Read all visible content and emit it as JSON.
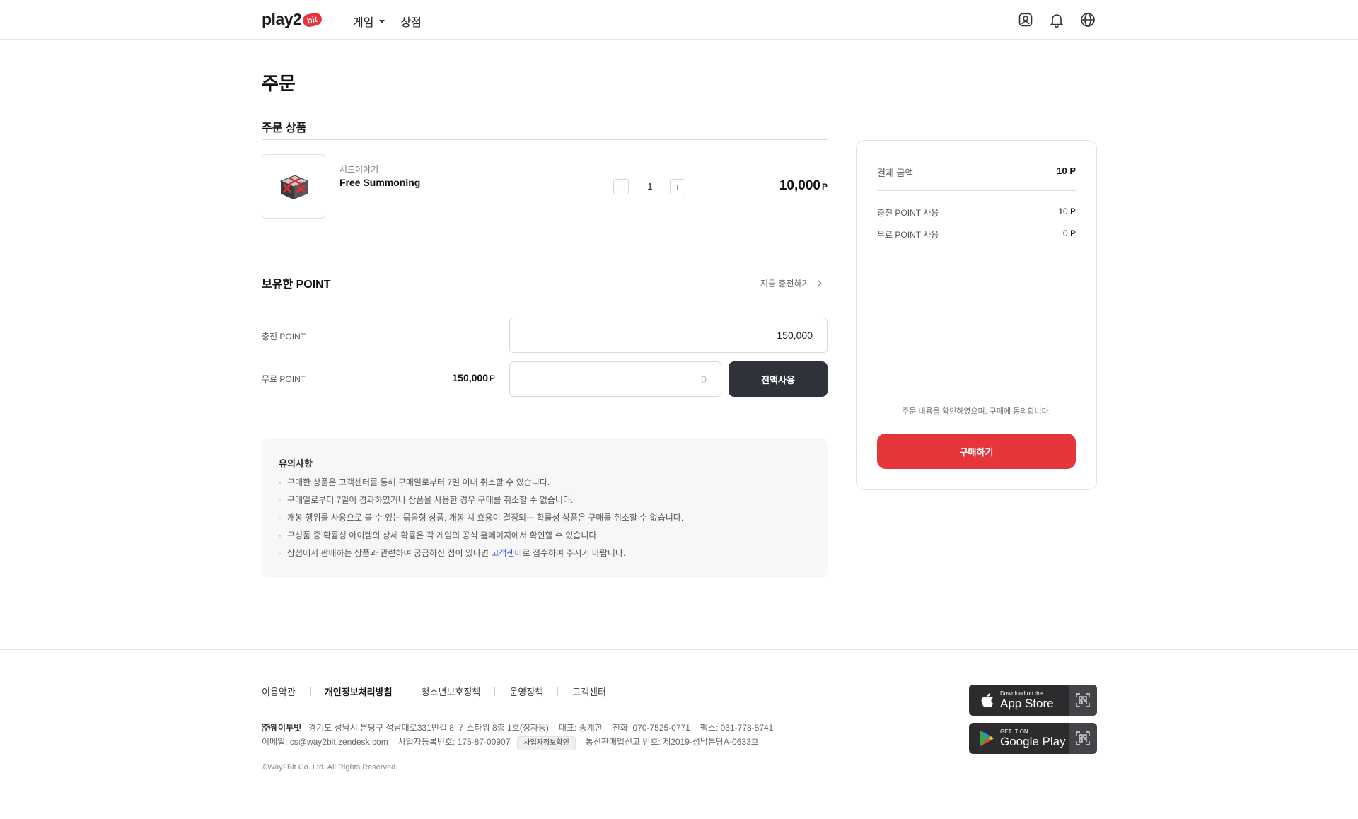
{
  "header": {
    "logo_text": "play2",
    "logo_badge": "bit",
    "nav": [
      {
        "label": "게임"
      },
      {
        "label": "상점"
      }
    ]
  },
  "page_title": "주문",
  "order": {
    "section_title": "주문 상품",
    "product": {
      "category": "시드이야기",
      "name": "Free Summoning",
      "quantity": "1",
      "price": "10,000",
      "price_unit": "P"
    }
  },
  "points": {
    "section_title": "보유한 POINT",
    "charge_link": "지금 충전하기",
    "charge_label": "충전 POINT",
    "charge_value": "150,000",
    "free_label": "무료 POINT",
    "free_have": "150,000",
    "free_have_unit": "P",
    "free_placeholder": "0",
    "use_all_button": "전액사용"
  },
  "notice": {
    "title": "유의사항",
    "items": [
      "구매한 상품은 고객센터를 통해 구매일로부터 7일 이내 취소할 수 있습니다.",
      "구매일로부터 7일이 경과하였거나 상품을 사용한 경우 구매를 취소할 수 없습니다.",
      "개봉 행위를 사용으로 볼 수 있는 묶음형 상품, 개봉 시 효용이 결정되는 확률성 상품은 구매를 취소할 수 없습니다.",
      "구성품 중 확률성 아이템의 상세 확률은 각 게임의 공식 홈페이지에서 확인할 수 있습니다."
    ],
    "last_item_prefix": "상점에서 판매하는 상품과 관련하여 궁금하신 점이 있다면 ",
    "last_item_link": "고객센터",
    "last_item_suffix": "로 접수하여 주시기 바랍니다."
  },
  "summary": {
    "total_label": "결제 금액",
    "total_value": "10 P",
    "charge_use_label": "충전 POINT 사용",
    "charge_use_value": "10 P",
    "free_use_label": "무료 POINT 사용",
    "free_use_value": "0 P",
    "agree_text": "주문 내용을 확인하였으며, 구매에 동의합니다.",
    "buy_button": "구매하기"
  },
  "footer": {
    "links": [
      {
        "label": "이용약관"
      },
      {
        "label": "개인정보처리방침"
      },
      {
        "label": "청소년보호정책"
      },
      {
        "label": "운영정책"
      },
      {
        "label": "고객센터"
      }
    ],
    "company_name": "㈜웨이투빗",
    "address": "경기도 성남시 분당구 성남대로331번길 8, 킨스타워 8층 1호(정자동)",
    "ceo": "대표: 송계한",
    "phone": "전화: 070-7525-0771",
    "fax": "팩스: 031-778-8741",
    "email": "이메일: cs@way2bit.zendesk.com",
    "biz_no": "사업자등록번호: 175-87-00907",
    "biz_info_button": "사업자정보확인",
    "ecommerce_no": "통신판매업신고 번호: 제2019-성남분당A-0633호",
    "copyright": "©Way2Bit Co. Ltd. All Rights Reserved.",
    "appstore_small": "Download on the",
    "appstore_big": "App Store",
    "googleplay_small": "GET IT ON",
    "googleplay_big": "Google Play"
  },
  "colors": {
    "accent_red": "#e5363b",
    "dark_button": "#2f3238",
    "link_blue": "#2c5bd8"
  }
}
